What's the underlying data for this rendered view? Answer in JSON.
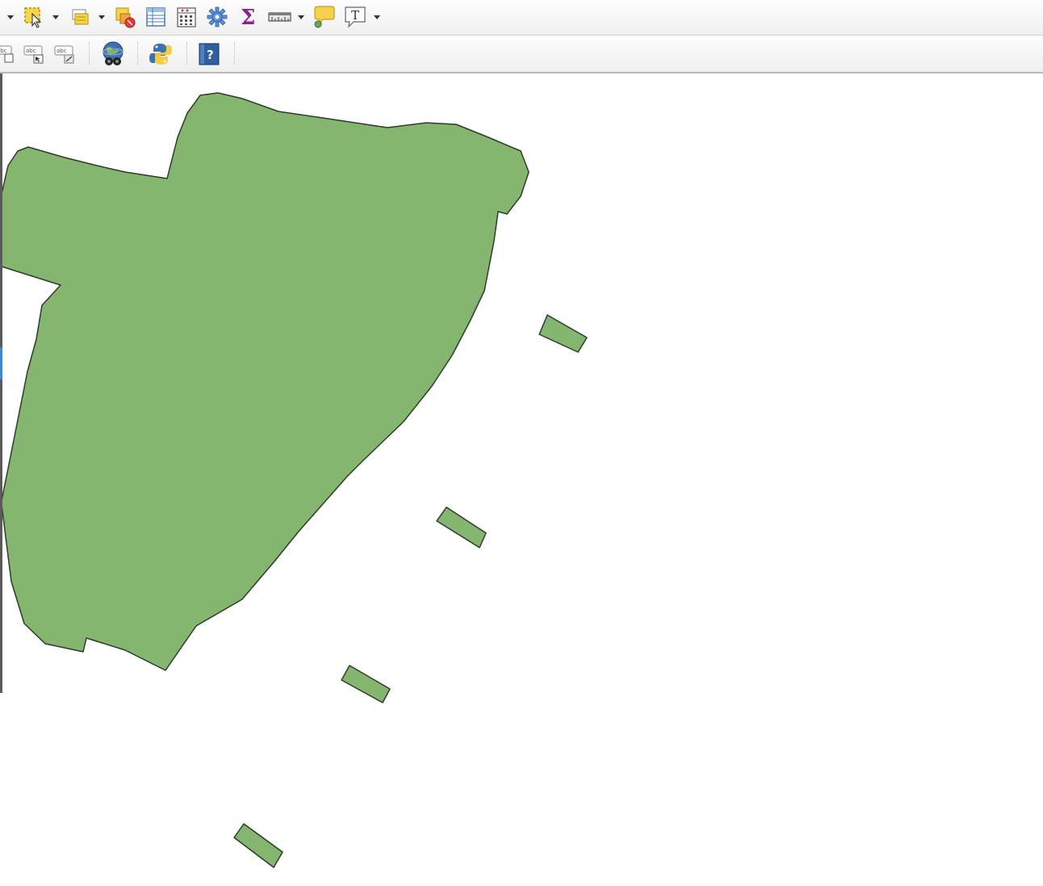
{
  "toolbar_row_1": {
    "items": [
      {
        "icon": "select-features-icon",
        "dropdown": true
      },
      {
        "icon": "deselect-features-icon",
        "dropdown": true
      },
      {
        "icon": "deselect-all-icon"
      },
      {
        "icon": "attribute-table-icon"
      },
      {
        "icon": "field-calculator-icon"
      },
      {
        "icon": "processing-toolbox-icon"
      },
      {
        "icon": "statistical-summary-icon"
      },
      {
        "icon": "measure-icon",
        "dropdown": true
      },
      {
        "icon": "map-tips-icon"
      },
      {
        "icon": "text-annotation-icon",
        "dropdown": true
      }
    ],
    "sigma_glyph": "Σ",
    "text_glyph": "T"
  },
  "toolbar_row_2": {
    "items": [
      {
        "icon": "pin-labels-icon",
        "label": "abc"
      },
      {
        "icon": "move-label-icon",
        "label": "abc"
      },
      {
        "icon": "change-label-icon",
        "label": "abc"
      },
      {
        "icon": "web-globe-icon"
      },
      {
        "icon": "python-console-icon"
      },
      {
        "icon": "help-icon",
        "label": "?"
      }
    ]
  },
  "map": {
    "fill_color": "#85b66f",
    "stroke_color": "#2d3b28",
    "feature_count": 5
  }
}
